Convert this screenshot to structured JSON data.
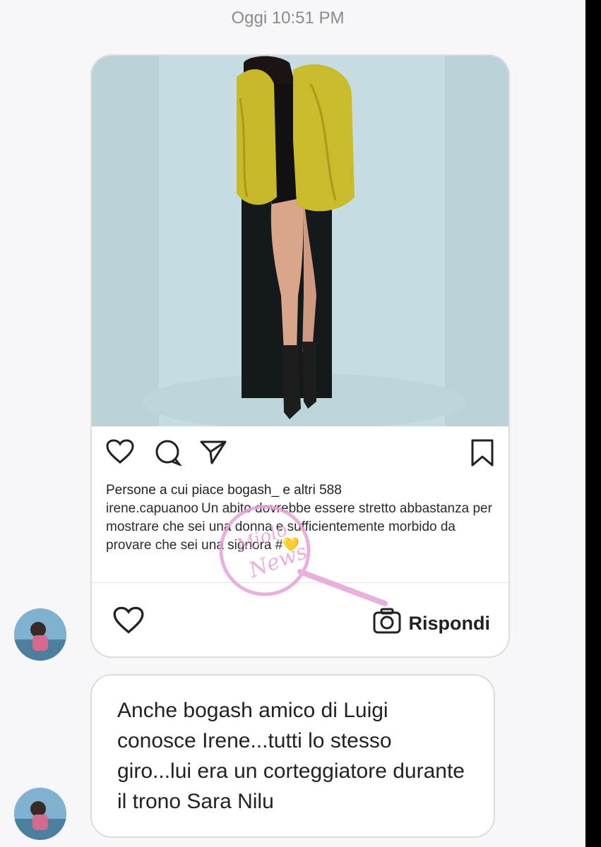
{
  "timestamp": "Oggi 10:51 PM",
  "shared_post": {
    "likes_text": "Persone a cui piace bogash_ e altri 588",
    "caption_user": "irene.capuanoo",
    "caption_text": "Un abito dovrebbe essere stretto abbastanza per mostrare che sei una donna e sufficientemente morbido da provare che sei una signora",
    "caption_suffix": "#💛",
    "reply_label": "Rispondi",
    "icons": {
      "like": "heart-icon",
      "comment": "comment-icon",
      "share": "send-icon",
      "save": "bookmark-icon",
      "camera": "camera-icon"
    }
  },
  "message": {
    "text": "Anche bogash amico di Luigi conosce Irene...tutti lo stesso giro...lui era un  corteggiatore durante il trono Sara Nilu"
  },
  "watermark": {
    "text_line1": "Miolo",
    "text_line2": "News"
  },
  "colors": {
    "coat": "#c8b92a",
    "photo_background": "#c5dde2",
    "watermark_pink": "#e6a3d6"
  }
}
